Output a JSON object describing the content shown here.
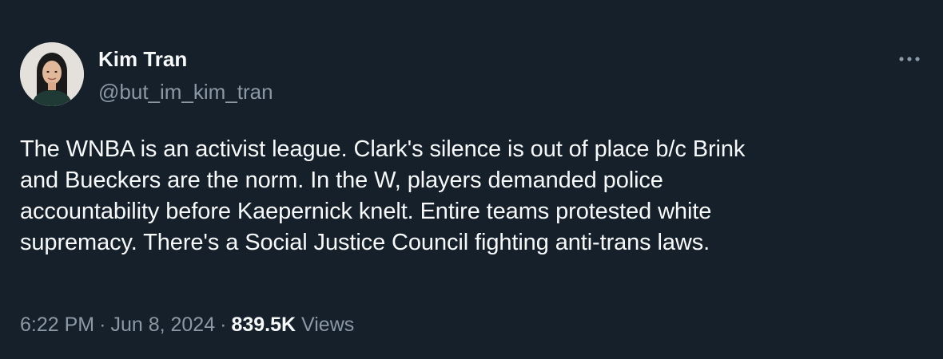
{
  "author": {
    "name": "Kim Tran",
    "handle": "@but_im_kim_tran",
    "avatar_icon": "profile-photo"
  },
  "tweet": {
    "lines": [
      "The WNBA is an activist league. Clark's silence is out of place b/c Brink",
      "and Bueckers are the norm. In the W, players demanded police",
      "accountability before Kaepernick knelt. Entire teams protested white",
      "supremacy. There's a Social Justice Council fighting anti-trans laws."
    ]
  },
  "meta": {
    "time": "6:22 PM",
    "separator": "·",
    "date": "Jun 8, 2024",
    "views_count": "839.5K",
    "views_label": "Views"
  },
  "icons": {
    "more": "more-horizontal-icon"
  },
  "colors": {
    "background": "#15202b",
    "primary_text": "#f7f9f9",
    "secondary_text": "#8b98a5"
  }
}
